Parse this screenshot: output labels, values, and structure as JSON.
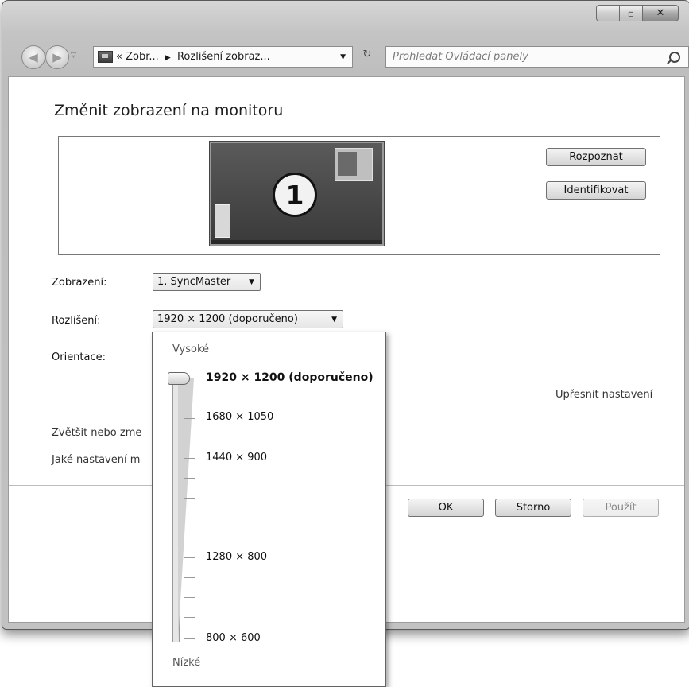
{
  "window": {
    "caption": {
      "minimize": "—",
      "maximize": "▫",
      "close": "✕"
    }
  },
  "nav": {
    "address": {
      "prefix": "«",
      "crumb1": "Zobr...",
      "crumb2": "Rozlišení zobraz..."
    },
    "search_placeholder": "Prohledat Ovládací panely"
  },
  "page": {
    "title": "Změnit zobrazení na monitoru",
    "monitor_number": "1",
    "detect_button": "Rozpoznat",
    "identify_button": "Identifikovat",
    "display_label": "Zobrazení:",
    "display_value": "1. SyncMaster",
    "resolution_label": "Rozlišení:",
    "resolution_value": "1920 × 1200 (doporučeno)",
    "orientation_label": "Orientace:",
    "advanced_link": "Upřesnit nastavení",
    "enlarge_link": "Zvětšit nebo zme",
    "which_link": "Jaké nastavení m",
    "ok_button": "OK",
    "cancel_button": "Storno",
    "apply_button": "Použít"
  },
  "resolution_dropdown": {
    "high_label": "Vysoké",
    "low_label": "Nízké",
    "selected_index": 0,
    "options": [
      "1920 × 1200 (doporučeno)",
      "1680 × 1050",
      "1440 × 900",
      "1280 × 800",
      "800 × 600"
    ]
  }
}
